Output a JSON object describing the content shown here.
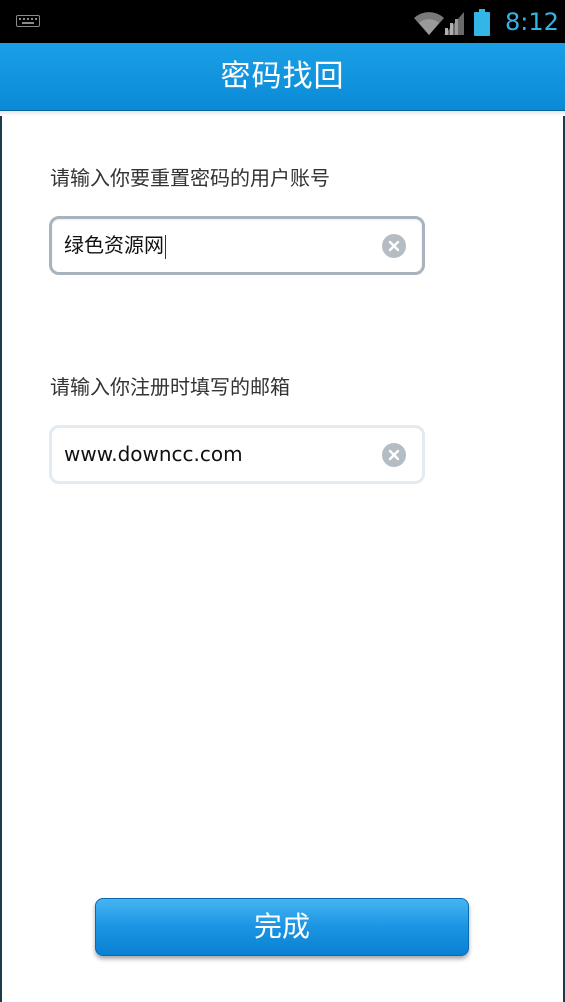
{
  "status_bar": {
    "time": "8:12",
    "icons": [
      "keyboard-icon",
      "wifi-icon",
      "signal-icon",
      "battery-icon"
    ]
  },
  "header": {
    "title": "密码找回"
  },
  "form": {
    "account": {
      "label": "请输入你要重置密码的用户账号",
      "value": "绿色资源网"
    },
    "email": {
      "label": "请输入你注册时填写的邮箱",
      "value": "www.downcc.com"
    }
  },
  "actions": {
    "done_label": "完成"
  },
  "colors": {
    "header": "#0b8ad6",
    "clock": "#33b5e5",
    "button": "#1a95e3"
  }
}
